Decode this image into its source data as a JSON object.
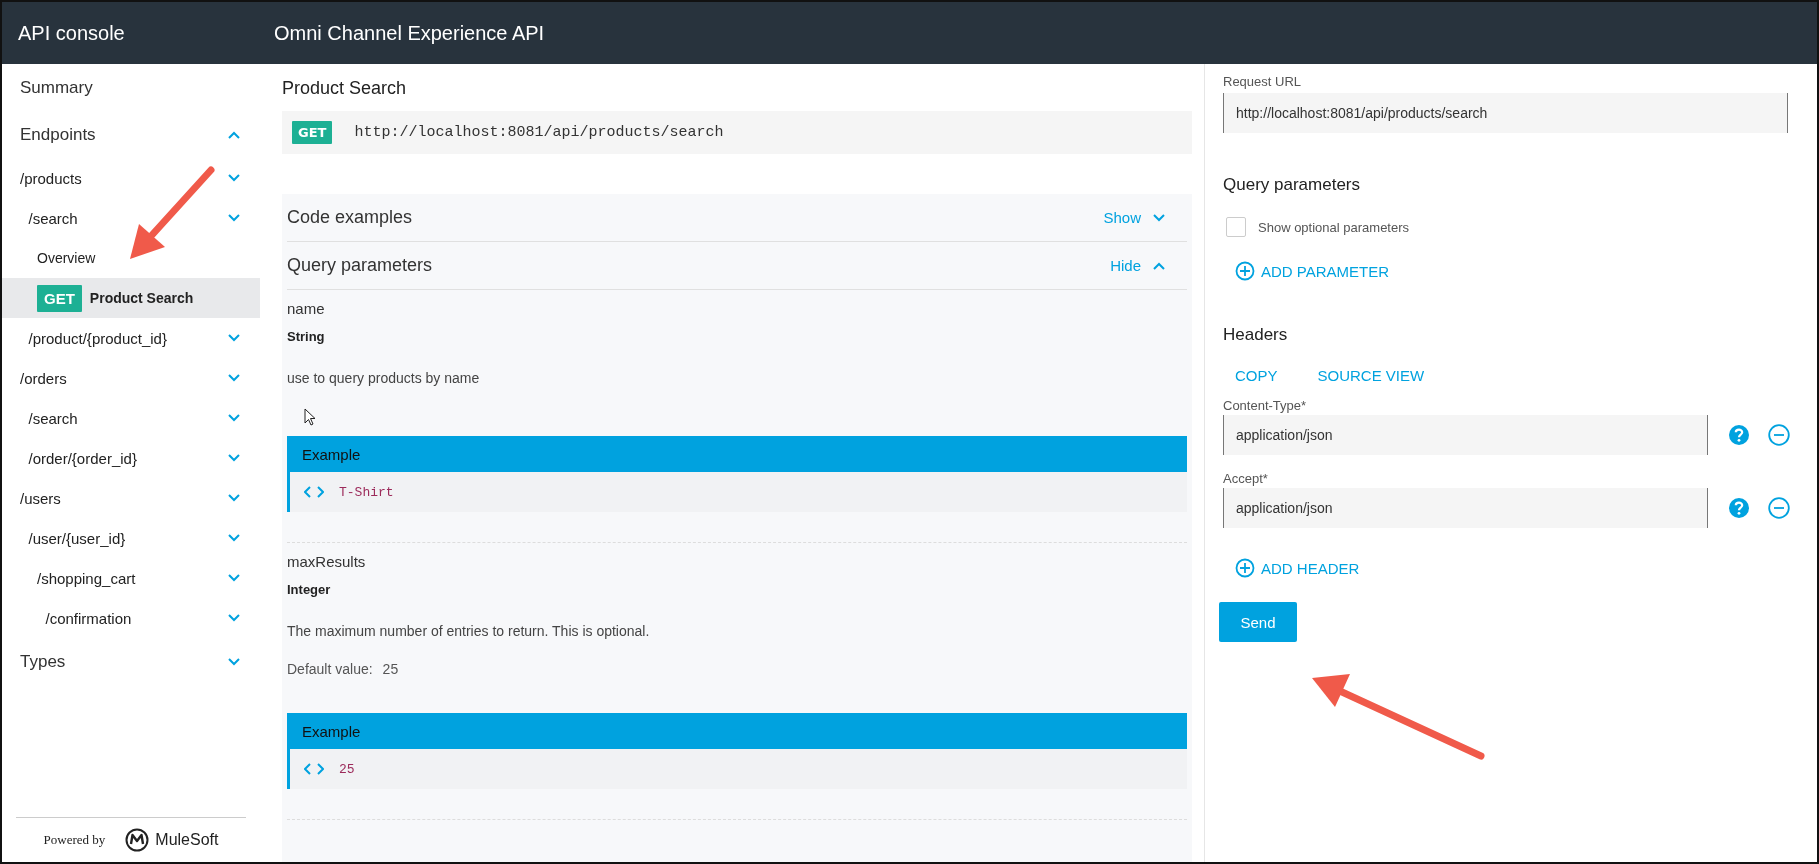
{
  "header": {
    "app_title": "API console",
    "api_title": "Omni Channel Experience API"
  },
  "sidebar": {
    "items": [
      {
        "kind": "section",
        "label": "Summary",
        "selected": false
      },
      {
        "kind": "section",
        "label": "Endpoints",
        "selected": false,
        "expanded": true,
        "children": [
          {
            "kind": "resource",
            "label": "/products",
            "selected": false,
            "expanded": false,
            "children": [
              {
                "kind": "resource",
                "label": "/search",
                "selected": false,
                "expanded": false,
                "children": [
                  {
                    "kind": "link",
                    "label": "Overview",
                    "selected": false
                  },
                  {
                    "kind": "method",
                    "method": "GET",
                    "label": "Product Search",
                    "selected": true
                  }
                ]
              },
              {
                "kind": "resource",
                "label": "/product/{product_id}",
                "selected": false,
                "expanded": false
              }
            ]
          },
          {
            "kind": "resource",
            "label": "/orders",
            "selected": false,
            "expanded": false,
            "children": [
              {
                "kind": "resource",
                "label": "/search",
                "selected": false,
                "expanded": false
              },
              {
                "kind": "resource",
                "label": "/order/{order_id}",
                "selected": false,
                "expanded": false
              }
            ]
          },
          {
            "kind": "resource",
            "label": "/users",
            "selected": false,
            "expanded": false,
            "children": [
              {
                "kind": "resource",
                "label": "/user/{user_id}",
                "selected": false,
                "expanded": false,
                "children": [
                  {
                    "kind": "resource",
                    "label": "/shopping_cart",
                    "selected": false,
                    "expanded": false,
                    "children": [
                      {
                        "kind": "resource",
                        "label": "/confirmation",
                        "selected": false,
                        "expanded": false
                      }
                    ]
                  }
                ]
              }
            ]
          }
        ]
      },
      {
        "kind": "section",
        "label": "Types",
        "selected": false,
        "expanded": false
      }
    ],
    "footer": {
      "powered_by": "Powered by",
      "brand": "MuleSoft"
    }
  },
  "main": {
    "title": "Product Search",
    "method": "GET",
    "url": "http://localhost:8081/api/products/search",
    "sections": [
      {
        "title": "Code examples",
        "toggle": "Show",
        "expanded": false
      },
      {
        "title": "Query parameters",
        "toggle": "Hide",
        "expanded": true
      }
    ],
    "parameters": [
      {
        "name": "name",
        "type": "String",
        "description": "use to query products by name",
        "example_label": "Example",
        "example_value": "T-Shirt"
      },
      {
        "name": "maxResults",
        "type": "Integer",
        "description": "The maximum number of entries to return. This is optional.",
        "default_label": "Default value:",
        "default_value": "25",
        "example_label": "Example",
        "example_value": "25"
      }
    ]
  },
  "request": {
    "url_label": "Request URL",
    "url": "http://localhost:8081/api/products/search",
    "query_title": "Query parameters",
    "optional_checkbox": {
      "label": "Show optional parameters",
      "checked": false
    },
    "add_parameter": "ADD PARAMETER",
    "headers_title": "Headers",
    "header_actions": [
      "COPY",
      "SOURCE VIEW"
    ],
    "headers": [
      {
        "name": "Content-Type*",
        "value": "application/json"
      },
      {
        "name": "Accept*",
        "value": "application/json"
      }
    ],
    "add_header": "ADD HEADER",
    "send": "Send"
  }
}
